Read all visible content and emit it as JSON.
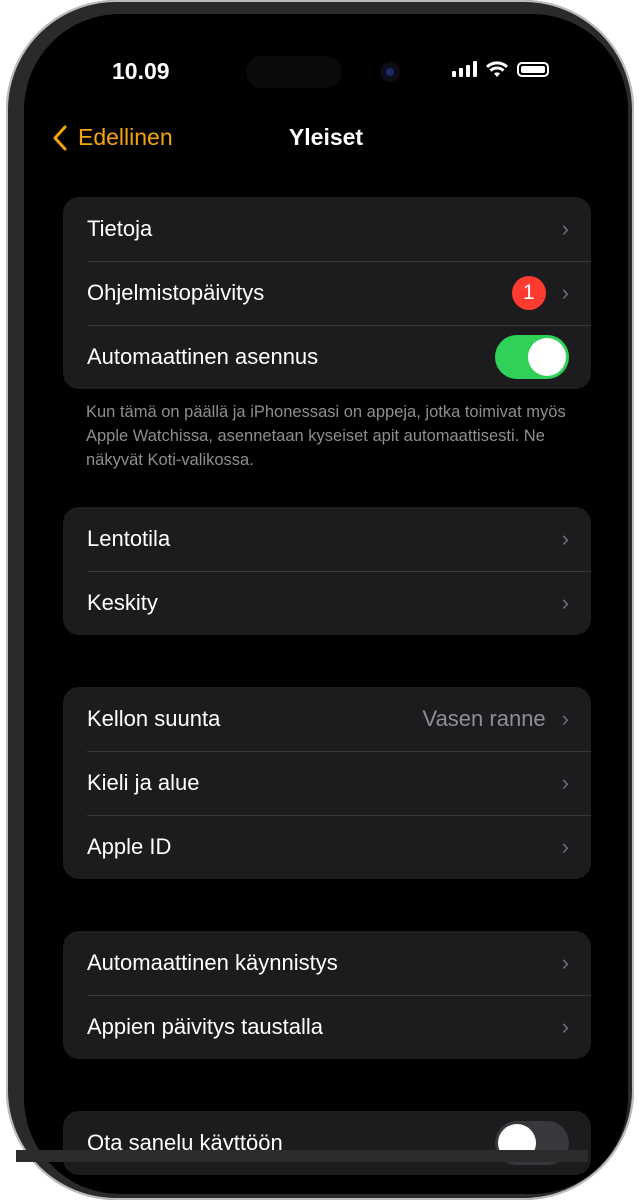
{
  "status_bar": {
    "time": "10.09"
  },
  "nav": {
    "back_label": "Edellinen",
    "title": "Yleiset"
  },
  "accent_color": "#f4a30c",
  "group1": {
    "rows": [
      {
        "label": "Tietoja"
      },
      {
        "label": "Ohjelmistopäivitys",
        "badge": "1"
      },
      {
        "label": "Automaattinen asennus",
        "toggle": true
      }
    ],
    "footnote": "Kun tämä on päällä ja iPhonessasi on appeja, jotka toimivat myös Apple Watchissa, asennetaan kyseiset apit automaattisesti. Ne näkyvät Koti-valikossa."
  },
  "group2": {
    "rows": [
      {
        "label": "Lentotila"
      },
      {
        "label": "Keskity"
      }
    ]
  },
  "group3": {
    "rows": [
      {
        "label": "Kellon suunta",
        "value": "Vasen ranne"
      },
      {
        "label": "Kieli ja alue"
      },
      {
        "label": "Apple ID"
      }
    ]
  },
  "group4": {
    "rows": [
      {
        "label": "Automaattinen käynnistys"
      },
      {
        "label": "Appien päivitys taustalla"
      }
    ]
  },
  "group5": {
    "rows": [
      {
        "label": "Ota sanelu käyttöön",
        "toggle": false
      }
    ]
  },
  "icons": {
    "back": "chevron-left-icon",
    "disclosure": "chevron-right-icon",
    "chevron_glyph": "›"
  }
}
